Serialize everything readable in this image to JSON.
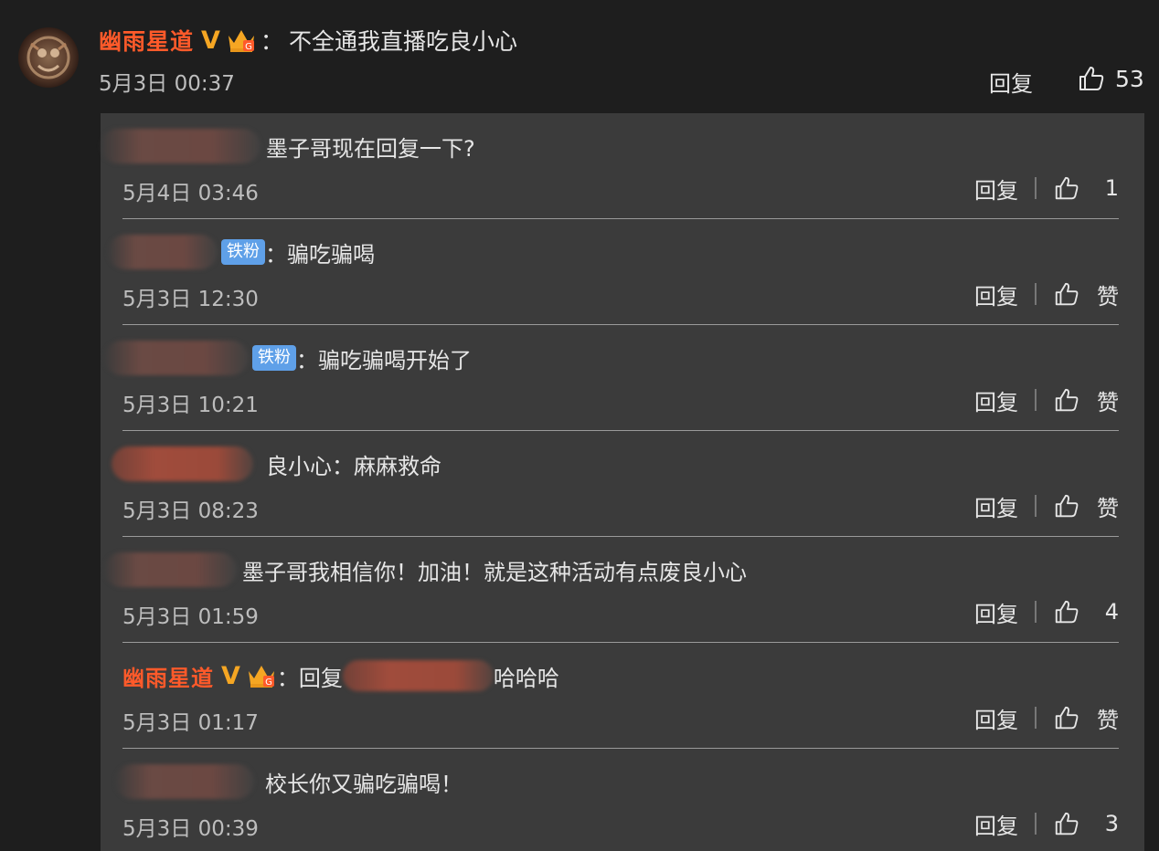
{
  "main_comment": {
    "username": "幽雨星道",
    "verified_badge": "V",
    "crown_icon": "crown-badge-icon",
    "colon": "：",
    "text": "不全通我直播吃良小心",
    "time": "5月3日 00:37",
    "reply_label": "回复",
    "like_count": "53"
  },
  "replies": [
    {
      "text": "墨子哥现在回复一下?",
      "time": "5月4日 03:46",
      "reply_label": "回复",
      "like": "1"
    },
    {
      "badge": "铁粉",
      "colon": "：",
      "text": "骗吃骗喝",
      "time": "5月3日 12:30",
      "reply_label": "回复",
      "like": "赞"
    },
    {
      "badge": "铁粉",
      "colon": "：",
      "text": "骗吃骗喝开始了",
      "time": "5月3日 10:21",
      "reply_label": "回复",
      "like": "赞"
    },
    {
      "text": "良小心：麻麻救命",
      "time": "5月3日 08:23",
      "reply_label": "回复",
      "like": "赞"
    },
    {
      "text": "墨子哥我相信你！加油！就是这种活动有点废良小心",
      "time": "5月3日 01:59",
      "reply_label": "回复",
      "like": "4"
    },
    {
      "username": "幽雨星道",
      "verified_badge": "V",
      "colon": "：",
      "prefix": "回复",
      "text": "哈哈哈",
      "time": "5月3日 01:17",
      "reply_label": "回复",
      "like": "赞"
    },
    {
      "text": "校长你又骗吃骗喝！",
      "time": "5月3日 00:39",
      "reply_label": "回复",
      "like": "3"
    }
  ],
  "colors": {
    "background": "#1e1e1e",
    "panel": "#3b3b3b",
    "username": "#ff5a2a",
    "verified": "#f5a623",
    "fan_badge": "#5fa0e8"
  }
}
